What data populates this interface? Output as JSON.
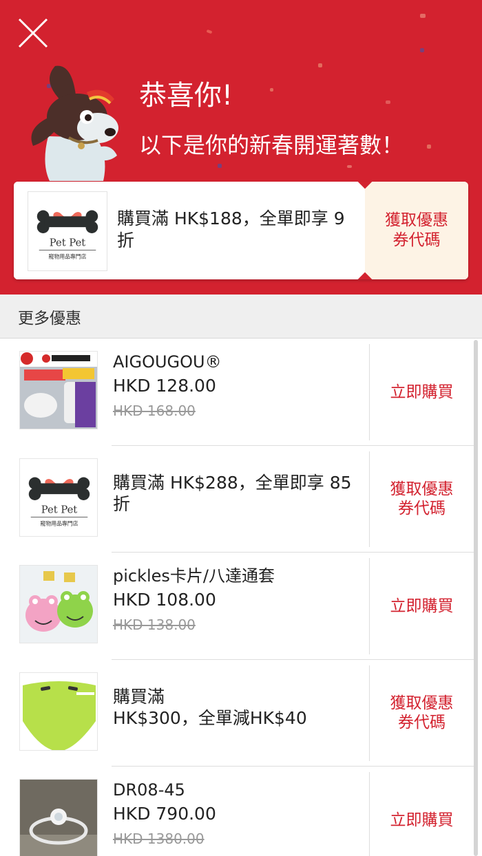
{
  "hero": {
    "title": "恭喜你!",
    "subtitle": "以下是你的新春開運著數！"
  },
  "main_coupon": {
    "logo_name": "Pet Pet",
    "logo_sub": "寵物用品專門店",
    "text": "購買滿 HK$188，全單即享 9 折",
    "action_line1": "獲取優惠",
    "action_line2": "券代碼"
  },
  "section": {
    "title": "更多優惠"
  },
  "items": [
    {
      "type": "product",
      "title": "AIGOUGOU®",
      "price": "HKD 128.00",
      "original": "HKD 168.00",
      "action": "立即購買",
      "thumb": "aigougou"
    },
    {
      "type": "coupon",
      "title": "購買滿 HK$288，全單即享 85 折",
      "action_line1": "獲取優惠",
      "action_line2": "券代碼",
      "thumb": "petpet",
      "logo_name": "Pet Pet",
      "logo_sub": "寵物用品專門店"
    },
    {
      "type": "product",
      "title": "pickles卡片/八達通套",
      "price": "HKD 108.00",
      "original": "HKD 138.00",
      "action": "立即購買",
      "thumb": "pickles"
    },
    {
      "type": "coupon",
      "title": "購買滿\nHK$300，全單減HK$40",
      "action_line1": "獲取優惠",
      "action_line2": "券代碼",
      "thumb": "lovelovemug"
    },
    {
      "type": "product",
      "title": "DR08-45",
      "price": "HKD 790.00",
      "original": "HKD 1380.00",
      "action": "立即購買",
      "thumb": "ring"
    }
  ],
  "colors": {
    "brand_red": "#d3222f",
    "coupon_bg": "#fdf3e5"
  },
  "icons": {
    "close": "close-icon"
  }
}
